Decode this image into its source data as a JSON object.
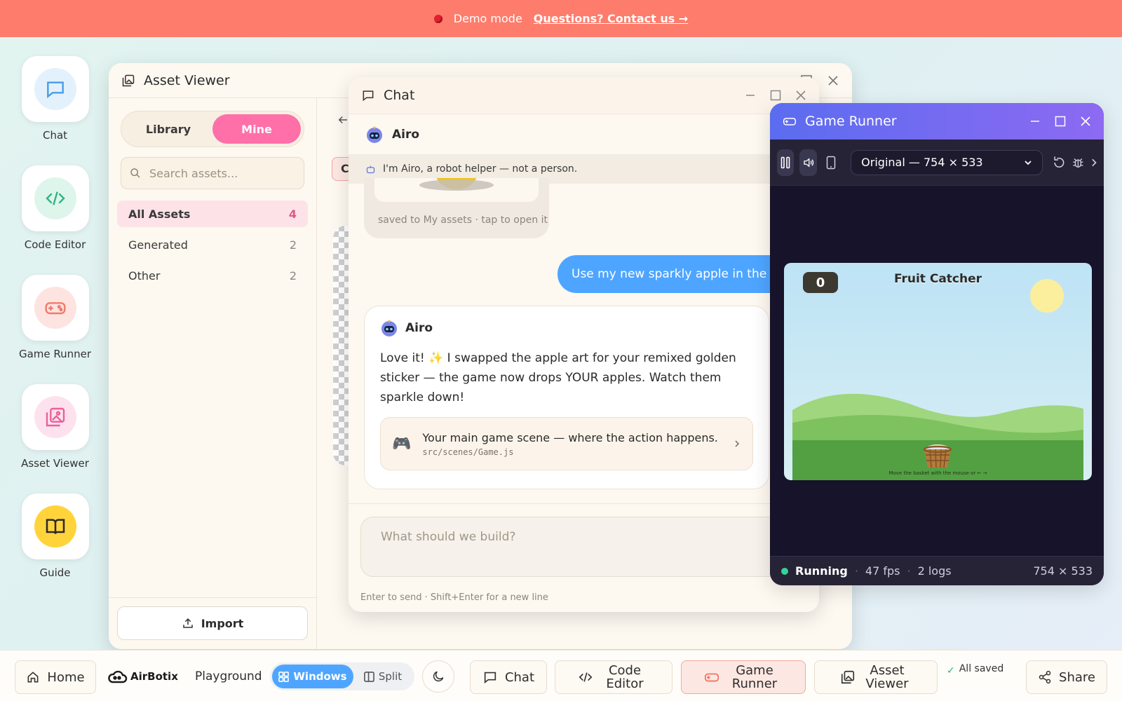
{
  "banner": {
    "text": "Demo mode",
    "link": "Questions? Contact us →"
  },
  "dock": [
    {
      "label": "Chat"
    },
    {
      "label": "Code Editor"
    },
    {
      "label": "Game Runner"
    },
    {
      "label": "Asset Viewer"
    },
    {
      "label": "Guide"
    }
  ],
  "asset_viewer": {
    "title": "Asset Viewer",
    "tabs": [
      "Library",
      "Mine"
    ],
    "active_tab": "Mine",
    "search_placeholder": "Search assets...",
    "categories": [
      {
        "label": "All Assets",
        "count": "4"
      },
      {
        "label": "Generated",
        "count": "2"
      },
      {
        "label": "Other",
        "count": "2"
      }
    ],
    "import_label": "Import",
    "tab_peek": "C"
  },
  "chat": {
    "title": "Chat",
    "bot_name": "Airo",
    "notice": "I'm Airo, a robot helper — not a person.",
    "prev_caption": "saved to My assets · tap to open it",
    "user_message": "Use my new sparkly apple in the ga",
    "reply_text": "Love it! ✨ I swapped the apple art for your remixed golden sticker — the game now drops YOUR apples. Watch them sparkle down!",
    "file_desc": "Your main game scene — where the action happens.",
    "file_path": "src/scenes/Game.js",
    "input_placeholder": "What should we build?",
    "hint": "Enter to send · Shift+Enter for a new line"
  },
  "game_runner": {
    "title": "Game Runner",
    "resolution_option": "Original — 754 × 533",
    "score": "0",
    "game_title": "Fruit Catcher",
    "instructions": "Move the basket with the mouse or ← →",
    "status": "Running",
    "fps": "47 fps",
    "logs": "2 logs",
    "size": "754 × 533"
  },
  "taskbar": {
    "home": "Home",
    "brand": "AirBotix",
    "playground": "Playground",
    "windows": "Windows",
    "split": "Split",
    "chat": "Chat",
    "code_editor": "Code Editor",
    "game_runner": "Game Runner",
    "asset_viewer": "Asset Viewer",
    "saved": "All saved",
    "share": "Share"
  },
  "colors": {
    "banner": "#fd7c6c",
    "accent_pink": "#ff6fa8",
    "accent_blue": "#4ea5ff",
    "guide_yellow": "#ffd43b",
    "running_green": "#34d399"
  }
}
